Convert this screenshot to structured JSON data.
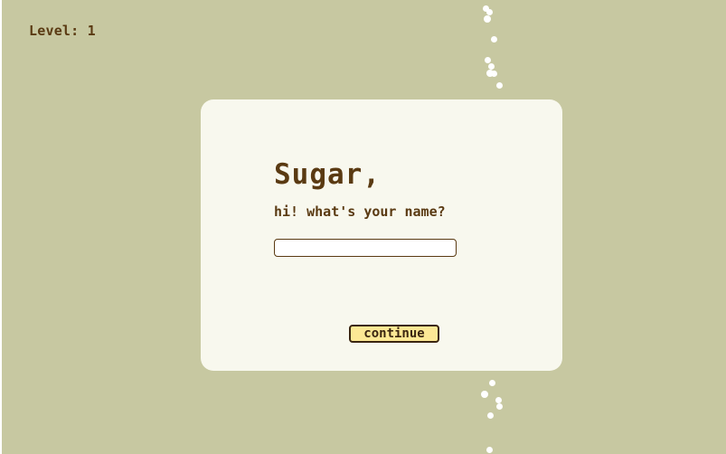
{
  "hud": {
    "level_label": "Level:",
    "level_value": "1"
  },
  "dialog": {
    "title": "Sugar,",
    "prompt": "hi! what's your name?",
    "name_input": {
      "value": "",
      "placeholder": ""
    },
    "continue_label": "continue"
  },
  "colors": {
    "background": "#c7c8a1",
    "panel": "#f8f8ee",
    "text": "#5a3a12",
    "button": "#fce895",
    "sugar_particle": "#ffffff"
  }
}
